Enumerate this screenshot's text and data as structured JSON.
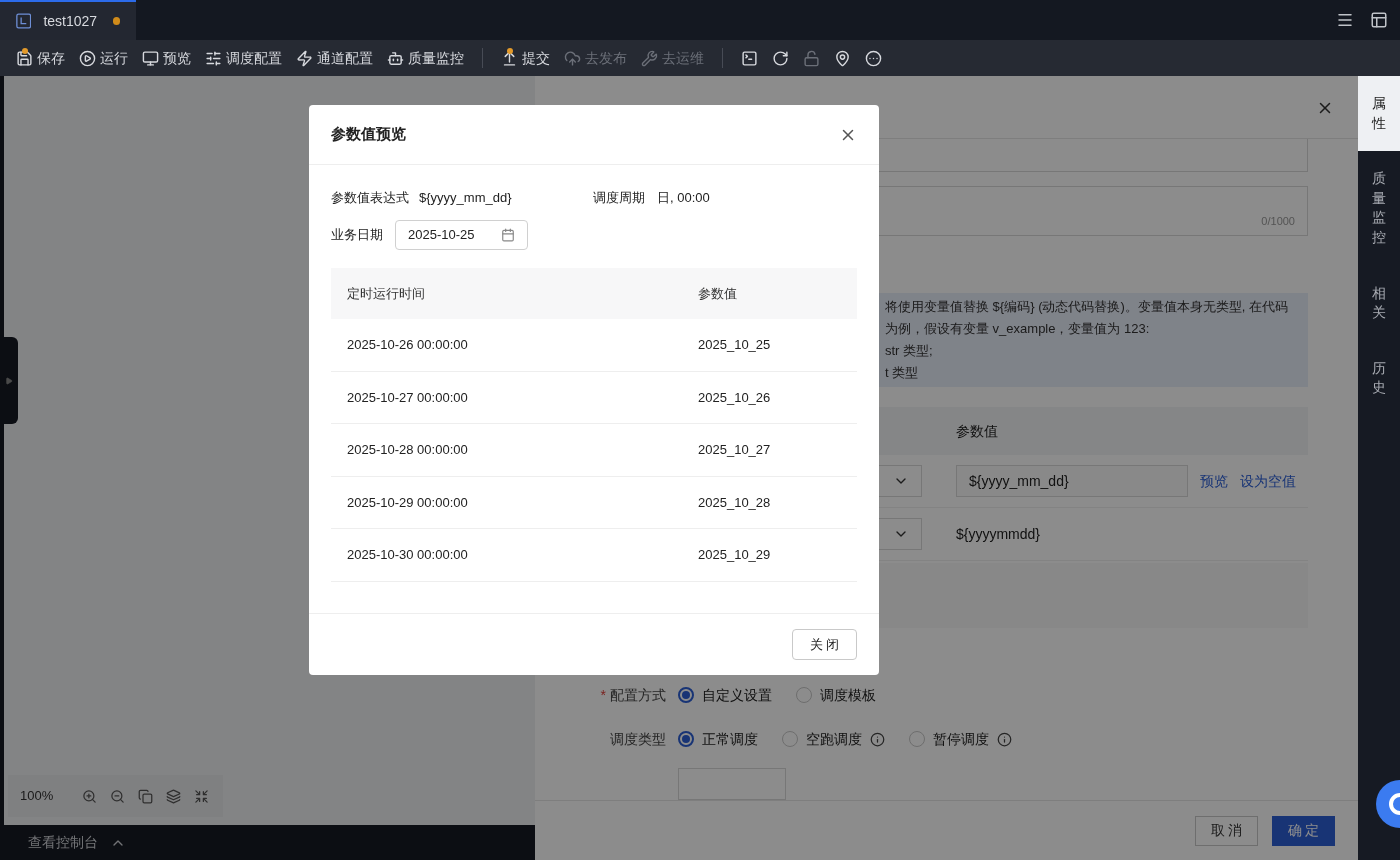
{
  "editor_tab": {
    "title": "test1027",
    "unsaved": true
  },
  "toolbar": {
    "groups": [
      {
        "items": [
          {
            "label": "保存",
            "disabled": false,
            "badge": true
          },
          {
            "label": "运行",
            "disabled": false,
            "badge": false
          },
          {
            "label": "预览",
            "disabled": false,
            "badge": false
          },
          {
            "label": "调度配置",
            "disabled": false,
            "badge": false
          },
          {
            "label": "通道配置",
            "disabled": false,
            "badge": false
          },
          {
            "label": "质量监控",
            "disabled": false,
            "badge": false
          }
        ]
      },
      {
        "items": [
          {
            "label": "提交",
            "disabled": false,
            "badge": true
          },
          {
            "label": "去发布",
            "disabled": true,
            "badge": false
          },
          {
            "label": "去运维",
            "disabled": true,
            "badge": false
          }
        ]
      },
      {
        "items": [
          {
            "disabled": false
          },
          {
            "disabled": false
          },
          {
            "disabled": true
          },
          {
            "disabled": false
          },
          {
            "disabled": false
          }
        ]
      }
    ]
  },
  "canvas": {
    "zoom": "100%",
    "console": "查看控制台"
  },
  "panel": {
    "char_count": "0/1000",
    "info_lines": [
      "将使用变量值替换 ${编码} (动态代码替换)。变量值本身无类型, 在代码",
      "为例，假设有变量 v_example，变量值为 123:",
      "str 类型;",
      "t 类型"
    ],
    "param_header": "参数值",
    "params": [
      {
        "kind": "input",
        "value": "${yyyy_mm_dd}",
        "links": [
          "预览",
          "设为空值"
        ]
      },
      {
        "kind": "text",
        "value": "${yyyymmdd}"
      }
    ],
    "config_mode": {
      "label": "配置方式",
      "required_mark": "*",
      "options": [
        {
          "label": "自定义设置",
          "selected": true,
          "info": false
        },
        {
          "label": "调度模板",
          "selected": false,
          "info": false
        }
      ]
    },
    "schedule_type": {
      "label": "调度类型",
      "options": [
        {
          "label": "正常调度",
          "selected": true,
          "info": false
        },
        {
          "label": "空跑调度",
          "selected": false,
          "info": true
        },
        {
          "label": "暂停调度",
          "selected": false,
          "info": true
        }
      ]
    },
    "buttons": {
      "cancel": "取 消",
      "ok": "确 定"
    }
  },
  "sidebar": [
    {
      "label": "属性",
      "selected": true
    },
    {
      "label": "质量监控",
      "selected": false
    },
    {
      "label": "相关",
      "selected": false
    },
    {
      "label": "历史",
      "selected": false
    }
  ],
  "modal": {
    "title": "参数值预览",
    "expression": {
      "label": "参数值表达式",
      "value": "${yyyy_mm_dd}"
    },
    "cycle": {
      "label": "调度周期",
      "value": "日, 00:00"
    },
    "date": {
      "label": "业务日期",
      "value": "2025-10-25"
    },
    "columns": [
      "定时运行时间",
      "参数值"
    ],
    "rows": [
      [
        "2025-10-26 00:00:00",
        "2025_10_25"
      ],
      [
        "2025-10-27 00:00:00",
        "2025_10_26"
      ],
      [
        "2025-10-28 00:00:00",
        "2025_10_27"
      ],
      [
        "2025-10-29 00:00:00",
        "2025_10_28"
      ],
      [
        "2025-10-30 00:00:00",
        "2025_10_29"
      ]
    ],
    "close_button": "关 闭"
  }
}
